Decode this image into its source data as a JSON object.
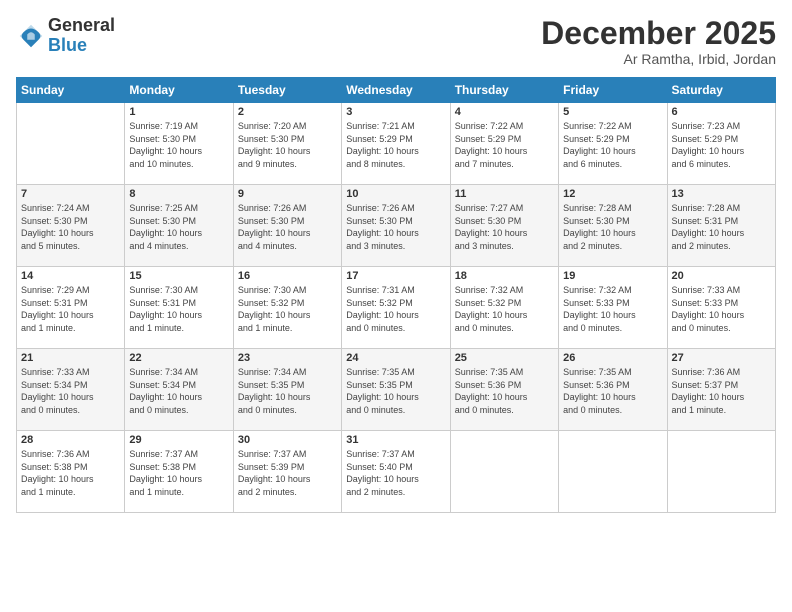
{
  "header": {
    "logo_general": "General",
    "logo_blue": "Blue",
    "month": "December 2025",
    "location": "Ar Ramtha, Irbid, Jordan"
  },
  "days_of_week": [
    "Sunday",
    "Monday",
    "Tuesday",
    "Wednesday",
    "Thursday",
    "Friday",
    "Saturday"
  ],
  "weeks": [
    [
      {
        "day": "",
        "content": ""
      },
      {
        "day": "1",
        "content": "Sunrise: 7:19 AM\nSunset: 5:30 PM\nDaylight: 10 hours\nand 10 minutes."
      },
      {
        "day": "2",
        "content": "Sunrise: 7:20 AM\nSunset: 5:30 PM\nDaylight: 10 hours\nand 9 minutes."
      },
      {
        "day": "3",
        "content": "Sunrise: 7:21 AM\nSunset: 5:29 PM\nDaylight: 10 hours\nand 8 minutes."
      },
      {
        "day": "4",
        "content": "Sunrise: 7:22 AM\nSunset: 5:29 PM\nDaylight: 10 hours\nand 7 minutes."
      },
      {
        "day": "5",
        "content": "Sunrise: 7:22 AM\nSunset: 5:29 PM\nDaylight: 10 hours\nand 6 minutes."
      },
      {
        "day": "6",
        "content": "Sunrise: 7:23 AM\nSunset: 5:29 PM\nDaylight: 10 hours\nand 6 minutes."
      }
    ],
    [
      {
        "day": "7",
        "content": "Sunrise: 7:24 AM\nSunset: 5:30 PM\nDaylight: 10 hours\nand 5 minutes."
      },
      {
        "day": "8",
        "content": "Sunrise: 7:25 AM\nSunset: 5:30 PM\nDaylight: 10 hours\nand 4 minutes."
      },
      {
        "day": "9",
        "content": "Sunrise: 7:26 AM\nSunset: 5:30 PM\nDaylight: 10 hours\nand 4 minutes."
      },
      {
        "day": "10",
        "content": "Sunrise: 7:26 AM\nSunset: 5:30 PM\nDaylight: 10 hours\nand 3 minutes."
      },
      {
        "day": "11",
        "content": "Sunrise: 7:27 AM\nSunset: 5:30 PM\nDaylight: 10 hours\nand 3 minutes."
      },
      {
        "day": "12",
        "content": "Sunrise: 7:28 AM\nSunset: 5:30 PM\nDaylight: 10 hours\nand 2 minutes."
      },
      {
        "day": "13",
        "content": "Sunrise: 7:28 AM\nSunset: 5:31 PM\nDaylight: 10 hours\nand 2 minutes."
      }
    ],
    [
      {
        "day": "14",
        "content": "Sunrise: 7:29 AM\nSunset: 5:31 PM\nDaylight: 10 hours\nand 1 minute."
      },
      {
        "day": "15",
        "content": "Sunrise: 7:30 AM\nSunset: 5:31 PM\nDaylight: 10 hours\nand 1 minute."
      },
      {
        "day": "16",
        "content": "Sunrise: 7:30 AM\nSunset: 5:32 PM\nDaylight: 10 hours\nand 1 minute."
      },
      {
        "day": "17",
        "content": "Sunrise: 7:31 AM\nSunset: 5:32 PM\nDaylight: 10 hours\nand 0 minutes."
      },
      {
        "day": "18",
        "content": "Sunrise: 7:32 AM\nSunset: 5:32 PM\nDaylight: 10 hours\nand 0 minutes."
      },
      {
        "day": "19",
        "content": "Sunrise: 7:32 AM\nSunset: 5:33 PM\nDaylight: 10 hours\nand 0 minutes."
      },
      {
        "day": "20",
        "content": "Sunrise: 7:33 AM\nSunset: 5:33 PM\nDaylight: 10 hours\nand 0 minutes."
      }
    ],
    [
      {
        "day": "21",
        "content": "Sunrise: 7:33 AM\nSunset: 5:34 PM\nDaylight: 10 hours\nand 0 minutes."
      },
      {
        "day": "22",
        "content": "Sunrise: 7:34 AM\nSunset: 5:34 PM\nDaylight: 10 hours\nand 0 minutes."
      },
      {
        "day": "23",
        "content": "Sunrise: 7:34 AM\nSunset: 5:35 PM\nDaylight: 10 hours\nand 0 minutes."
      },
      {
        "day": "24",
        "content": "Sunrise: 7:35 AM\nSunset: 5:35 PM\nDaylight: 10 hours\nand 0 minutes."
      },
      {
        "day": "25",
        "content": "Sunrise: 7:35 AM\nSunset: 5:36 PM\nDaylight: 10 hours\nand 0 minutes."
      },
      {
        "day": "26",
        "content": "Sunrise: 7:35 AM\nSunset: 5:36 PM\nDaylight: 10 hours\nand 0 minutes."
      },
      {
        "day": "27",
        "content": "Sunrise: 7:36 AM\nSunset: 5:37 PM\nDaylight: 10 hours\nand 1 minute."
      }
    ],
    [
      {
        "day": "28",
        "content": "Sunrise: 7:36 AM\nSunset: 5:38 PM\nDaylight: 10 hours\nand 1 minute."
      },
      {
        "day": "29",
        "content": "Sunrise: 7:37 AM\nSunset: 5:38 PM\nDaylight: 10 hours\nand 1 minute."
      },
      {
        "day": "30",
        "content": "Sunrise: 7:37 AM\nSunset: 5:39 PM\nDaylight: 10 hours\nand 2 minutes."
      },
      {
        "day": "31",
        "content": "Sunrise: 7:37 AM\nSunset: 5:40 PM\nDaylight: 10 hours\nand 2 minutes."
      },
      {
        "day": "",
        "content": ""
      },
      {
        "day": "",
        "content": ""
      },
      {
        "day": "",
        "content": ""
      }
    ]
  ]
}
